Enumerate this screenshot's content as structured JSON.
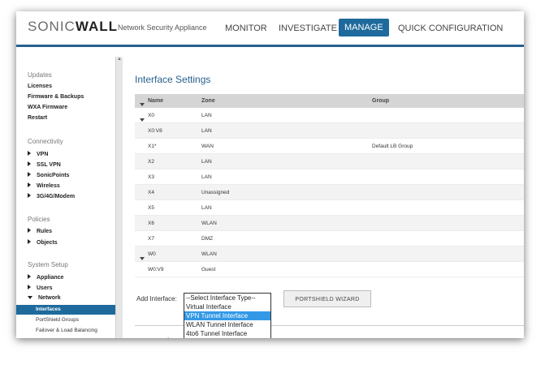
{
  "header": {
    "logo_light": "SONIC",
    "logo_bold": "WALL",
    "product": "Network Security Appliance",
    "nav": [
      "MONITOR",
      "INVESTIGATE",
      "MANAGE",
      "QUICK CONFIGURATION"
    ],
    "active_nav": "MANAGE",
    "accent_color": "#1e6a9c"
  },
  "sidebar": {
    "sections": [
      {
        "title": "Updates",
        "items": [
          "Licenses",
          "Firmware & Backups",
          "WXA Firmware",
          "Restart"
        ]
      },
      {
        "title": "Connectivity",
        "items": [
          "VPN",
          "SSL VPN",
          "SonicPoints",
          "Wireless",
          "3G/4G/Modem"
        ]
      },
      {
        "title": "Policies",
        "items": [
          "Rules",
          "Objects"
        ]
      },
      {
        "title": "System Setup",
        "items": [
          "Appliance",
          "Users",
          "Network"
        ]
      }
    ],
    "network_sub": [
      "Interfaces",
      "PortShield Groups",
      "Failover & Load Balancing"
    ],
    "selected": "Interfaces"
  },
  "main": {
    "title": "Interface Settings",
    "columns": [
      "Name",
      "Zone",
      "Group"
    ],
    "rows": [
      {
        "name": "X0",
        "zone": "LAN",
        "group": ""
      },
      {
        "name": "X0:V8",
        "zone": "LAN",
        "group": ""
      },
      {
        "name": "X1*",
        "zone": "WAN",
        "group": "Default LB Group"
      },
      {
        "name": "X2",
        "zone": "LAN",
        "group": ""
      },
      {
        "name": "X3",
        "zone": "LAN",
        "group": ""
      },
      {
        "name": "X4",
        "zone": "Unassigned",
        "group": ""
      },
      {
        "name": "X5",
        "zone": "LAN",
        "group": ""
      },
      {
        "name": "X6",
        "zone": "WLAN",
        "group": ""
      },
      {
        "name": "X7",
        "zone": "DMZ",
        "group": ""
      },
      {
        "name": "W0",
        "zone": "WLAN",
        "group": ""
      },
      {
        "name": "W0:V9",
        "zone": "Guest",
        "group": ""
      }
    ],
    "add_interface_label": "Add Interface:",
    "add_interface_options": [
      "--Select Interface Type--",
      "Virtual Interface",
      "VPN Tunnel Interface",
      "WLAN Tunnel Interface",
      "4to6 Tunnel Interface"
    ],
    "add_interface_highlight": "VPN Tunnel Interface",
    "portshield_button": "PORTSHIELD WIZARD"
  }
}
